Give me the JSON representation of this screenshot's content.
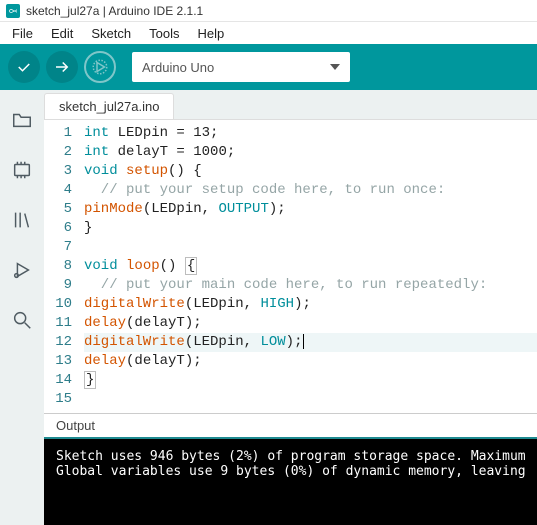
{
  "titlebar": {
    "text": "sketch_jul27a | Arduino IDE 2.1.1"
  },
  "menubar": {
    "items": [
      "File",
      "Edit",
      "Sketch",
      "Tools",
      "Help"
    ]
  },
  "toolbar": {
    "board": "Arduino Uno"
  },
  "sidebar": {
    "icons": [
      "folder-icon",
      "board-manager-icon",
      "library-icon",
      "debug-icon",
      "search-icon"
    ]
  },
  "tab": {
    "label": "sketch_jul27a.ino"
  },
  "code_lines": [
    [
      {
        "t": "int ",
        "c": "tok-type"
      },
      {
        "t": "LEDpin ",
        "c": "tok-plain"
      },
      {
        "t": "= ",
        "c": "tok-plain"
      },
      {
        "t": "13",
        "c": "tok-plain"
      },
      {
        "t": ";",
        "c": "tok-plain"
      }
    ],
    [
      {
        "t": "int ",
        "c": "tok-type"
      },
      {
        "t": "delayT ",
        "c": "tok-plain"
      },
      {
        "t": "= ",
        "c": "tok-plain"
      },
      {
        "t": "1000",
        "c": "tok-plain"
      },
      {
        "t": ";",
        "c": "tok-plain"
      }
    ],
    [
      {
        "t": "void ",
        "c": "tok-kw"
      },
      {
        "t": "setup",
        "c": "tok-func"
      },
      {
        "t": "() {",
        "c": "tok-plain"
      }
    ],
    [
      {
        "t": "  // put your setup code here, to run once:",
        "c": "tok-comment"
      }
    ],
    [
      {
        "t": "pinMode",
        "c": "tok-func"
      },
      {
        "t": "(LEDpin, ",
        "c": "tok-plain"
      },
      {
        "t": "OUTPUT",
        "c": "tok-const"
      },
      {
        "t": ");",
        "c": "tok-plain"
      }
    ],
    [
      {
        "t": "}",
        "c": "tok-plain"
      }
    ],
    [
      {
        "t": "",
        "c": "tok-plain"
      }
    ],
    [
      {
        "t": "void ",
        "c": "tok-kw"
      },
      {
        "t": "loop",
        "c": "tok-func"
      },
      {
        "t": "() ",
        "c": "tok-plain"
      },
      {
        "t": "{",
        "c": "tok-plain",
        "hl": true
      }
    ],
    [
      {
        "t": "  // put your main code here, to run repeatedly:",
        "c": "tok-comment"
      }
    ],
    [
      {
        "t": "digitalWrite",
        "c": "tok-func"
      },
      {
        "t": "(LEDpin, ",
        "c": "tok-plain"
      },
      {
        "t": "HIGH",
        "c": "tok-const"
      },
      {
        "t": ");",
        "c": "tok-plain"
      }
    ],
    [
      {
        "t": "delay",
        "c": "tok-func"
      },
      {
        "t": "(delayT);",
        "c": "tok-plain"
      }
    ],
    [
      {
        "t": "digitalWrite",
        "c": "tok-func"
      },
      {
        "t": "(LEDpin, ",
        "c": "tok-plain"
      },
      {
        "t": "LOW",
        "c": "tok-const"
      },
      {
        "t": ");",
        "c": "tok-plain",
        "cursor": true
      }
    ],
    [
      {
        "t": "delay",
        "c": "tok-func"
      },
      {
        "t": "(delayT);",
        "c": "tok-plain"
      }
    ],
    [
      {
        "t": "}",
        "c": "tok-plain",
        "hl": true
      }
    ],
    [
      {
        "t": "",
        "c": "tok-plain"
      }
    ]
  ],
  "current_line": 12,
  "output": {
    "label": "Output",
    "lines": [
      "Sketch uses 946 bytes (2%) of program storage space. Maximum ",
      "Global variables use 9 bytes (0%) of dynamic memory, leaving "
    ]
  }
}
